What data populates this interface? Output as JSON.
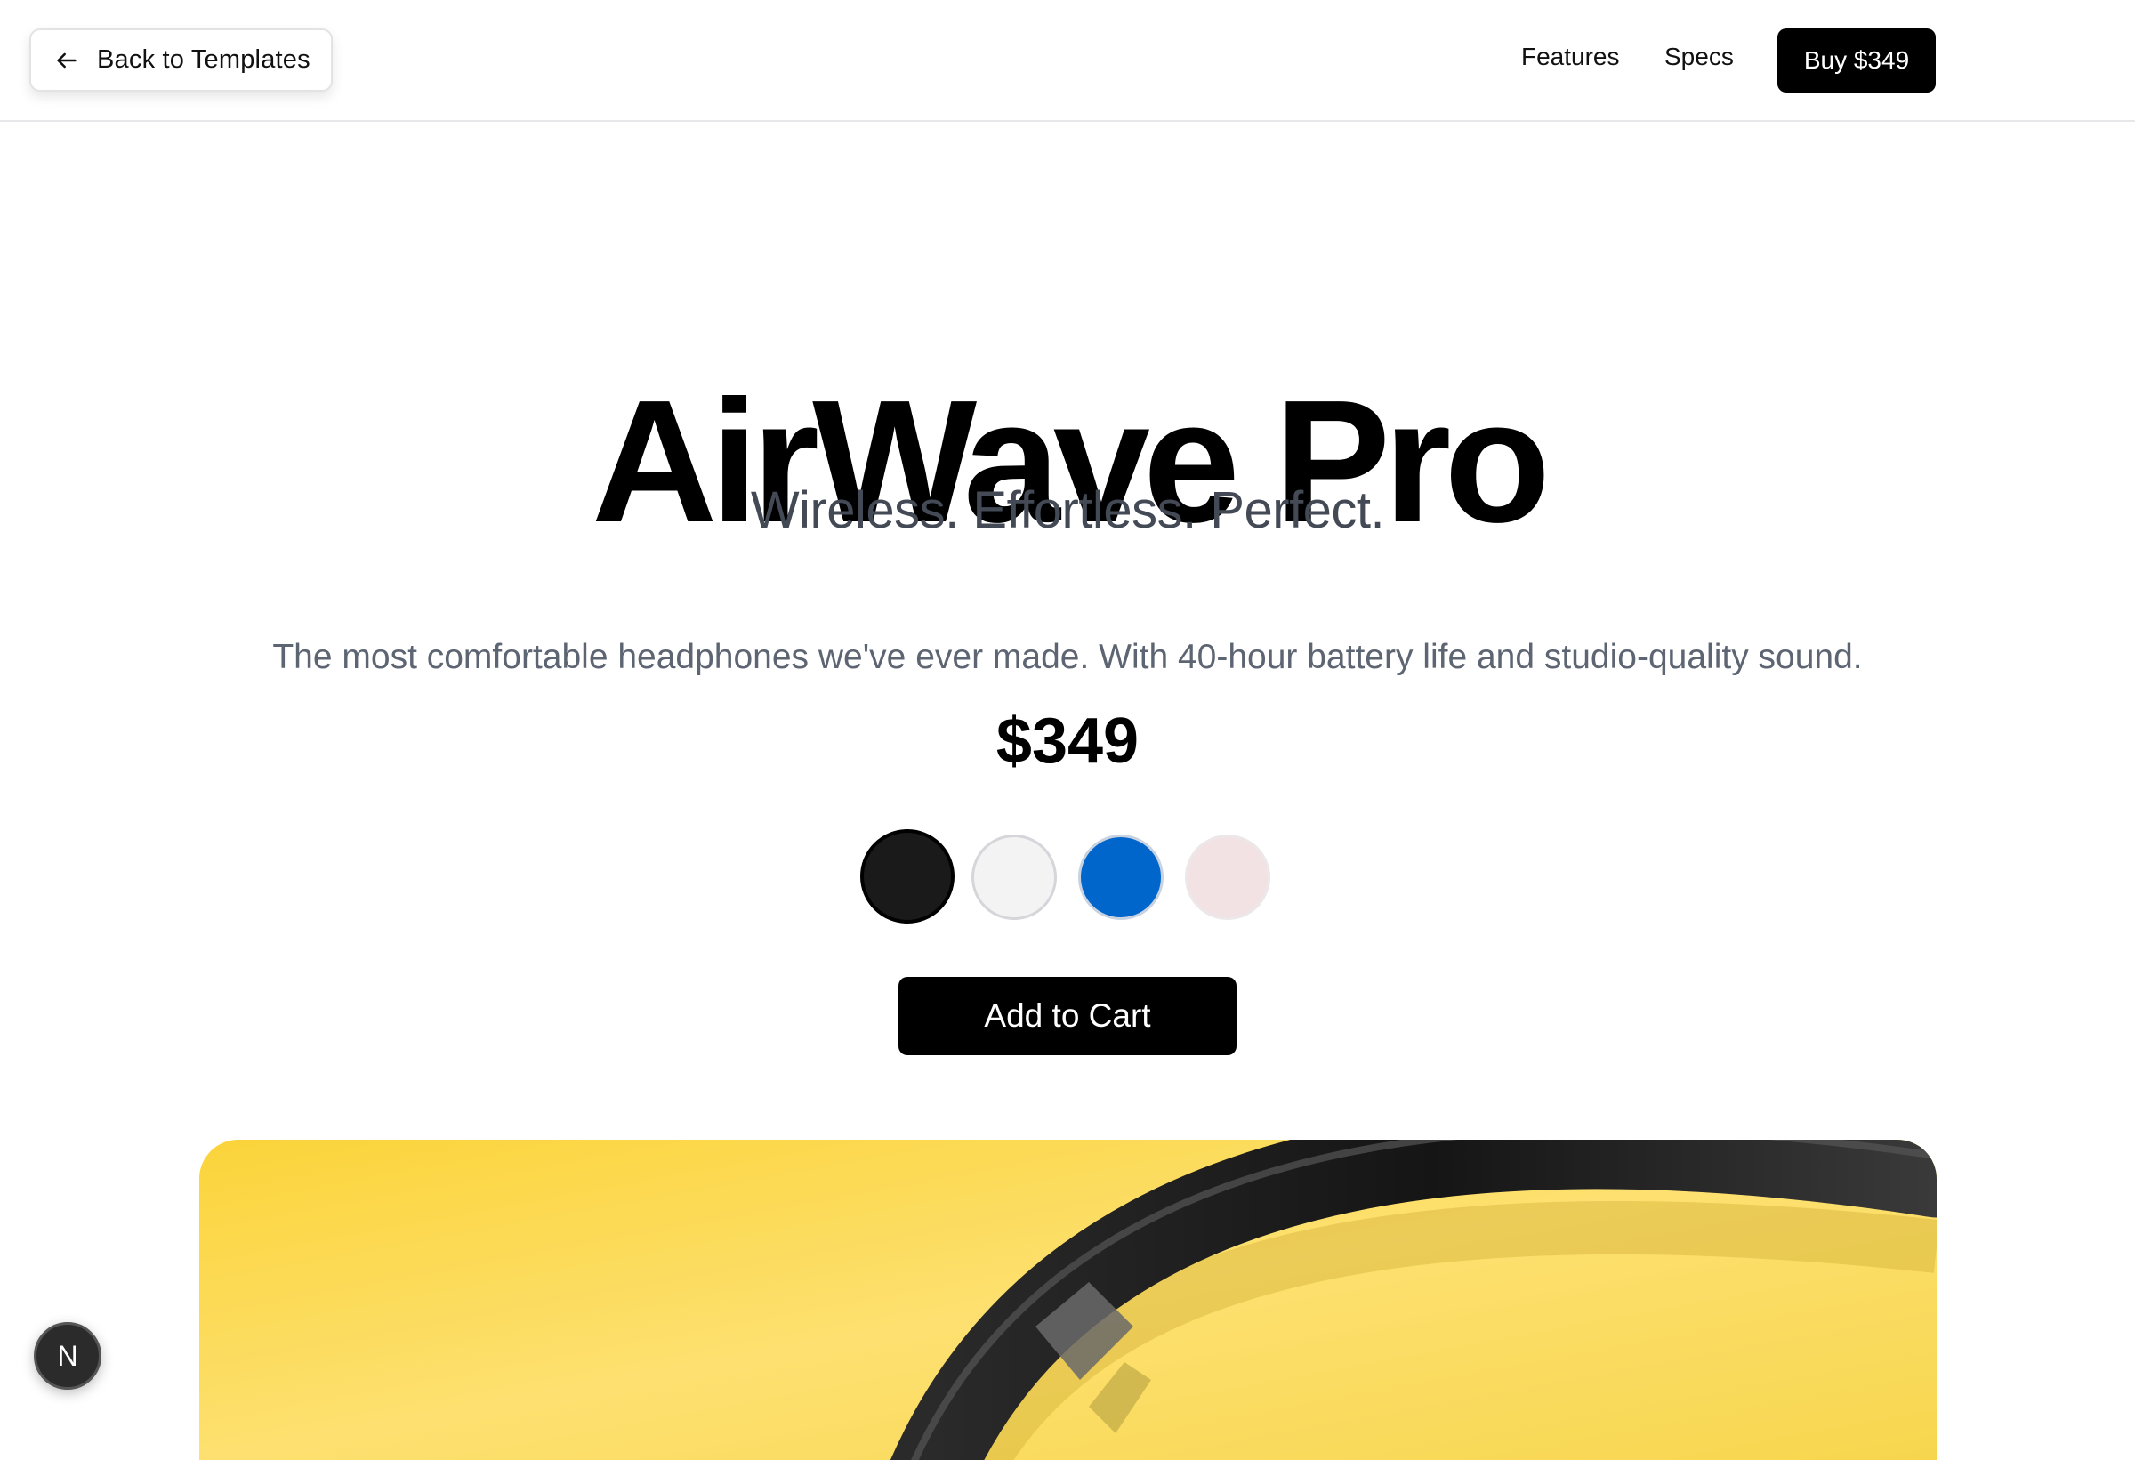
{
  "header": {
    "back_label": "Back to Templates",
    "nav": {
      "features": "Features",
      "specs": "Specs"
    },
    "buy_label": "Buy $349"
  },
  "hero": {
    "title": "AirWave Pro",
    "subtitle": "Wireless. Effortless. Perfect.",
    "description": "The most comfortable headphones we've ever made. With 40-hour battery life and studio-quality sound.",
    "price": "$349"
  },
  "colors": {
    "options": [
      "#1a1a1a",
      "#f3f3f4",
      "#0066cc",
      "#f2e2e4"
    ],
    "selected_index": 0
  },
  "cart": {
    "label": "Add to Cart"
  },
  "product_image": {
    "background_color": "#fbd84a"
  },
  "next_badge": {
    "glyph": "N"
  }
}
